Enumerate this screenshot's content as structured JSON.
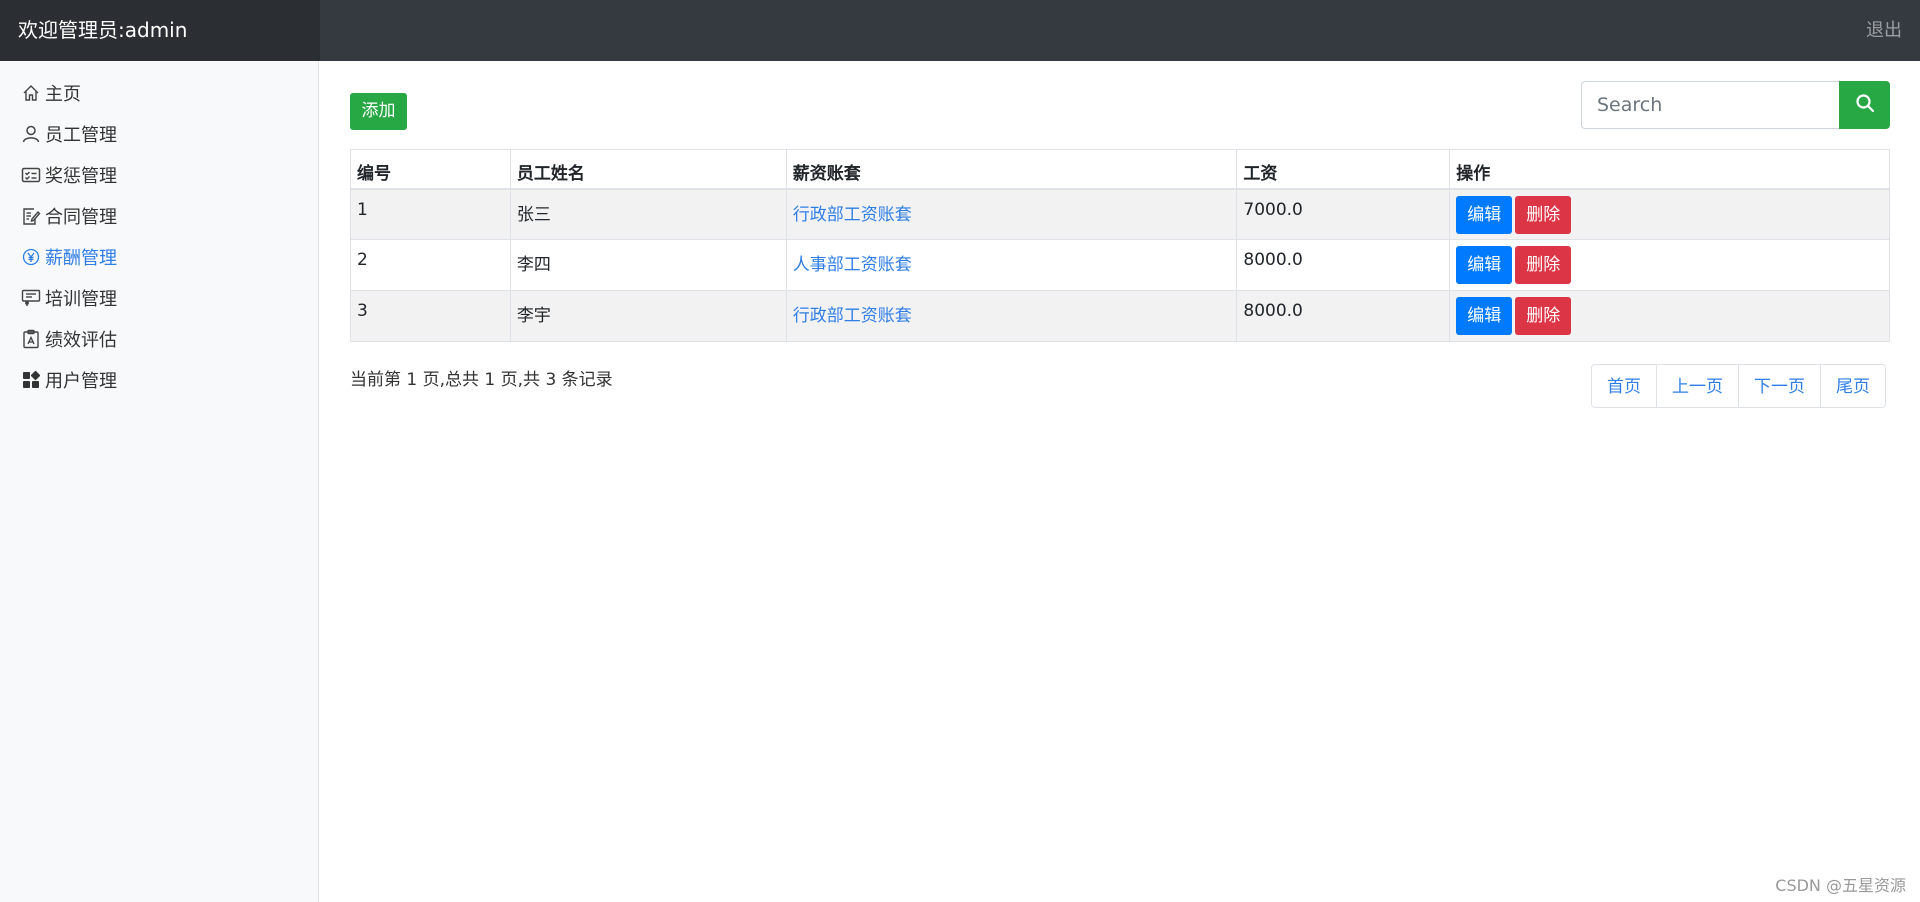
{
  "header": {
    "title": "欢迎管理员:admin",
    "logout": "退出"
  },
  "sidebar": {
    "items": [
      {
        "label": "主页",
        "icon": "home-icon"
      },
      {
        "label": "员工管理",
        "icon": "user-icon"
      },
      {
        "label": "奖惩管理",
        "icon": "card-checklist-icon"
      },
      {
        "label": "合同管理",
        "icon": "document-edit-icon"
      },
      {
        "label": "薪酬管理",
        "icon": "yen-icon",
        "active": true
      },
      {
        "label": "培训管理",
        "icon": "presentation-icon"
      },
      {
        "label": "绩效评估",
        "icon": "clipboard-icon"
      },
      {
        "label": "用户管理",
        "icon": "grid-icon"
      }
    ]
  },
  "toolbar": {
    "add_label": "添加",
    "search_placeholder": "Search"
  },
  "table": {
    "headers": [
      "编号",
      "员工姓名",
      "薪资账套",
      "工资",
      "操作"
    ],
    "rows": [
      {
        "id": "1",
        "name": "张三",
        "account": "行政部工资账套",
        "salary": "7000.0"
      },
      {
        "id": "2",
        "name": "李四",
        "account": "人事部工资账套",
        "salary": "8000.0"
      },
      {
        "id": "3",
        "name": "李宇",
        "account": "行政部工资账套",
        "salary": "8000.0"
      }
    ],
    "edit_label": "编辑",
    "delete_label": "删除"
  },
  "pagination": {
    "info": "当前第 1 页,总共 1 页,共 3 条记录",
    "first": "首页",
    "prev": "上一页",
    "next": "下一页",
    "last": "尾页"
  },
  "watermark": "CSDN @五星资源",
  "colors": {
    "topbar": "#343a40",
    "accent": "#2f7ee6",
    "success": "#28a745",
    "primary": "#007bff",
    "danger": "#dc3545"
  }
}
